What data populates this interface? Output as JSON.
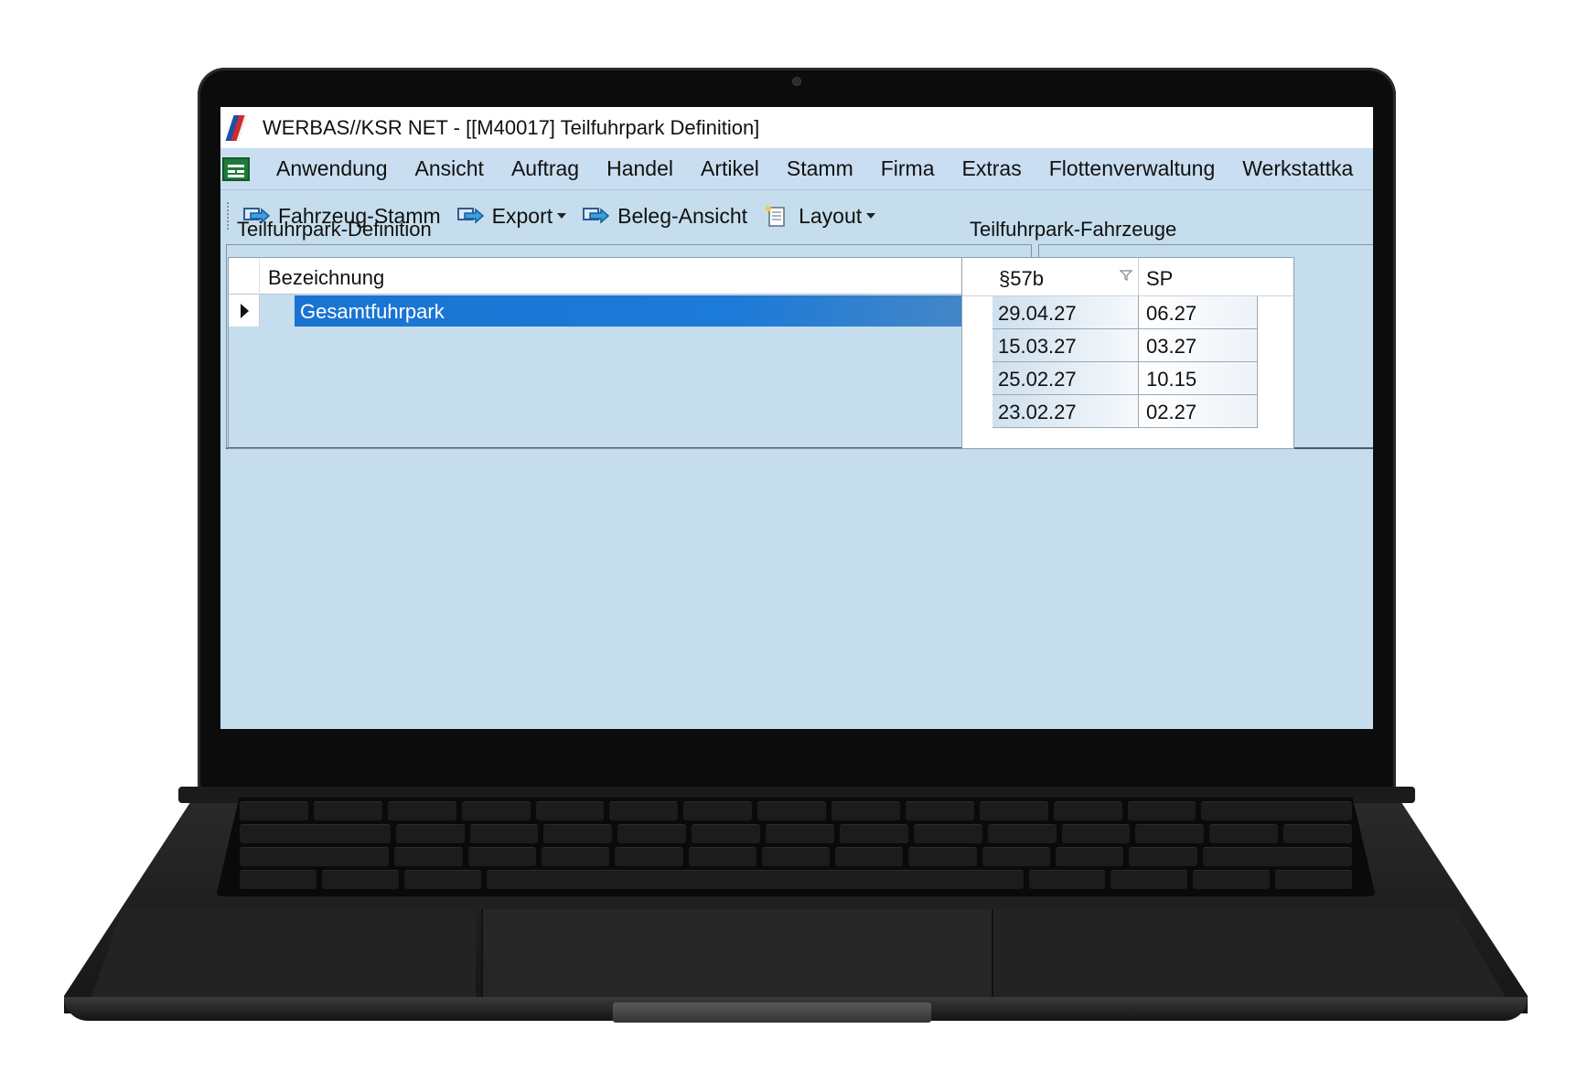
{
  "window": {
    "title": "WERBAS//KSR NET - [[M40017] Teilfuhrpark Definition]"
  },
  "menu": {
    "items": [
      "Anwendung",
      "Ansicht",
      "Auftrag",
      "Handel",
      "Artikel",
      "Stamm",
      "Firma",
      "Extras",
      "Flottenverwaltung",
      "Werkstattka"
    ]
  },
  "toolbar": {
    "fahrzeug_stamm": "Fahrzeug-Stamm",
    "export": "Export",
    "beleg_ansicht": "Beleg-Ansicht",
    "layout": "Layout"
  },
  "left_panel": {
    "title": "Teilfuhrpark-Definition",
    "column": "Bezeichnung",
    "rows": [
      "Gesamtfuhrpark"
    ]
  },
  "right_panel": {
    "title": "Teilfuhrpark-Fahrzeuge",
    "columns": [
      "§57b",
      "SP"
    ],
    "rows": [
      [
        "29.04.27",
        "06.27"
      ],
      [
        "15.03.27",
        "03.27"
      ],
      [
        "25.02.27",
        "10.15"
      ],
      [
        "23.02.27",
        "02.27"
      ]
    ]
  },
  "colors": {
    "selection": "#1a73d2",
    "background": "#c5ddec"
  }
}
